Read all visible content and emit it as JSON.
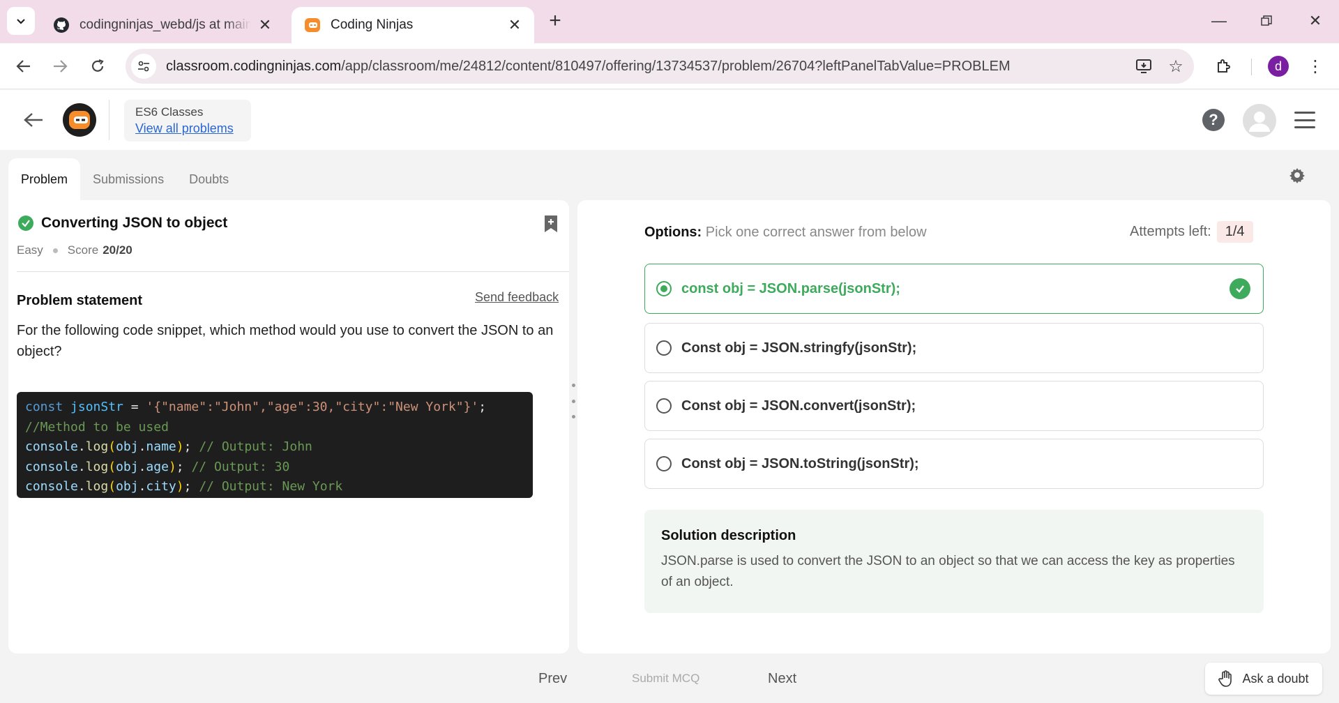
{
  "browser": {
    "tabs": [
      {
        "title": "codingninjas_webd/js at main · ",
        "active": false,
        "icon": "github-icon"
      },
      {
        "title": "Coding Ninjas",
        "active": true,
        "icon": "coding-ninjas-icon"
      }
    ],
    "url_host": "classroom.codingninjas.com",
    "url_path": "/app/classroom/me/24812/content/810497/offering/13734537/problem/26704?leftPanelTabValue=PROBLEM",
    "profile_initial": "d"
  },
  "header": {
    "course": "ES6 Classes",
    "view_all": "View all problems"
  },
  "panel_tabs": [
    "Problem",
    "Submissions",
    "Doubts"
  ],
  "problem": {
    "title": "Converting JSON to object",
    "difficulty": "Easy",
    "score_label": "Score",
    "score_value": "20/20",
    "statement_heading": "Problem statement",
    "feedback": "Send feedback",
    "question": "For the following code snippet, which method would you use to convert the JSON to an object?"
  },
  "code": {
    "line1_kw": "const",
    "line1_var": "jsonStr",
    "line1_eq": " = ",
    "line1_str": "'{\"name\":\"John\",\"age\":30,\"city\":\"New York\"}'",
    "line1_end": ";",
    "line2": "//Method to be used",
    "log1_obj": "obj",
    "log1_prop": "name",
    "log1_comment": "// Output: John",
    "log2_obj": "obj",
    "log2_prop": "age",
    "log2_comment": "// Output: 30",
    "log3_obj": "obj",
    "log3_prop": "city",
    "log3_comment": "// Output: New York",
    "console": "console",
    "log": "log"
  },
  "mcq": {
    "options_label": "Options:",
    "options_hint": "Pick one correct answer from below",
    "attempts_label": "Attempts left:",
    "attempts_value": "1/4",
    "options": [
      {
        "text": "const obj = JSON.parse(jsonStr);",
        "correct": true,
        "selected": true
      },
      {
        "text": "Const obj = JSON.stringfy(jsonStr);",
        "correct": false,
        "selected": false
      },
      {
        "text": "Const obj = JSON.convert(jsonStr);",
        "correct": false,
        "selected": false
      },
      {
        "text": "Const obj = JSON.toString(jsonStr);",
        "correct": false,
        "selected": false
      }
    ],
    "solution_heading": "Solution description",
    "solution_body": "JSON.parse is used to convert the JSON to an object so that we can access the key as properties of an object."
  },
  "footer": {
    "prev": "Prev",
    "submit": "Submit MCQ",
    "next": "Next",
    "ask": "Ask a doubt"
  },
  "colors": {
    "accent_green": "#3daa5c",
    "tabbar_bg": "#f2dcea",
    "link_blue": "#2b67d1",
    "brand_orange": "#f78c2a"
  }
}
